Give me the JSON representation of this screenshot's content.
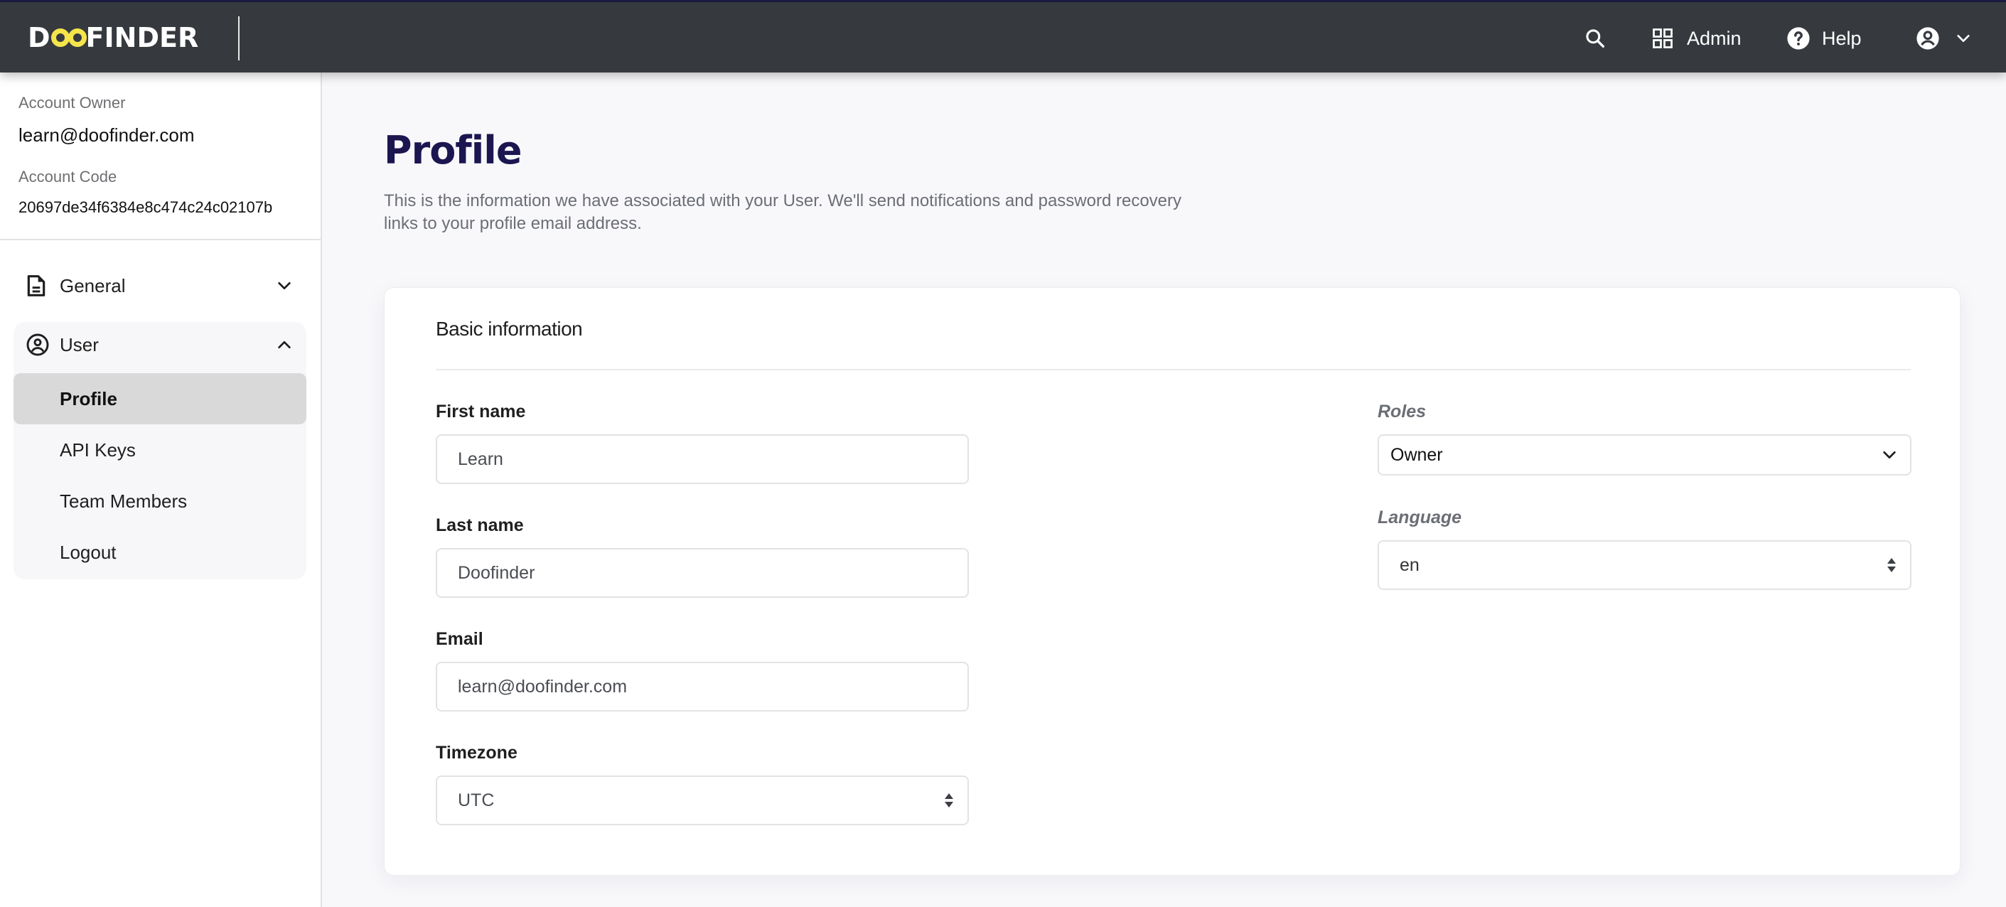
{
  "header": {
    "logo_text_left": "D",
    "logo_text_right": "FINDER",
    "logo_accent_color": "#f5e44a",
    "icons": {
      "search": "search-icon",
      "admin": "grid-icon",
      "help": "help-circle-icon",
      "user": "user-circle-icon",
      "user_menu": "chevron-down-icon"
    },
    "admin_label": "Admin",
    "help_label": "Help"
  },
  "sidebar": {
    "account_owner_label": "Account Owner",
    "account_owner_value": "learn@doofinder.com",
    "account_code_label": "Account Code",
    "account_code_value": "20697de34f6384e8c474c24c02107b",
    "nav": [
      {
        "label": "General",
        "icon": "document-icon",
        "expanded": false
      },
      {
        "label": "User",
        "icon": "user-circle-icon",
        "expanded": true,
        "items": [
          {
            "label": "Profile",
            "active": true
          },
          {
            "label": "API Keys",
            "active": false
          },
          {
            "label": "Team Members",
            "active": false
          },
          {
            "label": "Logout",
            "active": false
          }
        ]
      }
    ]
  },
  "main": {
    "title": "Profile",
    "description": "This is the information we have associated with your User. We'll send notifications and password recovery links to your profile email address.",
    "title_color": "#1b1650",
    "card": {
      "title": "Basic information",
      "fields": {
        "first_name": {
          "label": "First name",
          "value": "Learn"
        },
        "last_name": {
          "label": "Last name",
          "value": "Doofinder"
        },
        "email": {
          "label": "Email",
          "value": "learn@doofinder.com"
        },
        "timezone": {
          "label": "Timezone",
          "value": "UTC"
        },
        "roles": {
          "label": "Roles",
          "value": "Owner"
        },
        "language": {
          "label": "Language",
          "value": "en"
        }
      }
    }
  }
}
